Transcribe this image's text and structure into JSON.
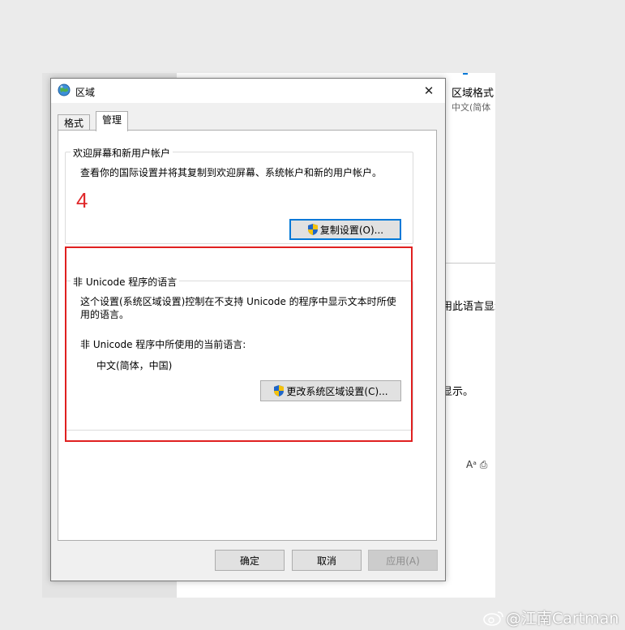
{
  "background_window": {
    "heading": "区域格式",
    "subtext": "中文(简体",
    "partial_text_1": "用此语言显示",
    "partial_text_2": "显示。",
    "icon_glyphs": "Aᵃ ⎙"
  },
  "dialog": {
    "title": "区域",
    "close_glyph": "✕",
    "tabs": [
      {
        "label": "格式",
        "active": false
      },
      {
        "label": "管理",
        "active": true
      }
    ],
    "welcome_group": {
      "legend": "欢迎屏幕和新用户帐户",
      "description": "查看你的国际设置并将其复制到欢迎屏幕、系统帐户和新的用户帐户。",
      "copy_button": "复制设置(O)..."
    },
    "unicode_group": {
      "legend": "非 Unicode 程序的语言",
      "description": "这个设置(系统区域设置)控制在不支持 Unicode 的程序中显示文本时所使用的语言。",
      "current_label": "非 Unicode 程序中所使用的当前语言:",
      "current_value": "中文(简体，中国)",
      "change_button": "更改系统区域设置(C)..."
    },
    "footer": {
      "ok": "确定",
      "cancel": "取消",
      "apply": "应用(A)"
    }
  },
  "annotation": {
    "step_number": "4",
    "highlight_color": "#e02020"
  },
  "watermark": {
    "text": "@江南Cartman"
  },
  "colors": {
    "accent": "#0078d7",
    "dialog_bg": "#f0f0f0",
    "annotation_red": "#e02020"
  }
}
